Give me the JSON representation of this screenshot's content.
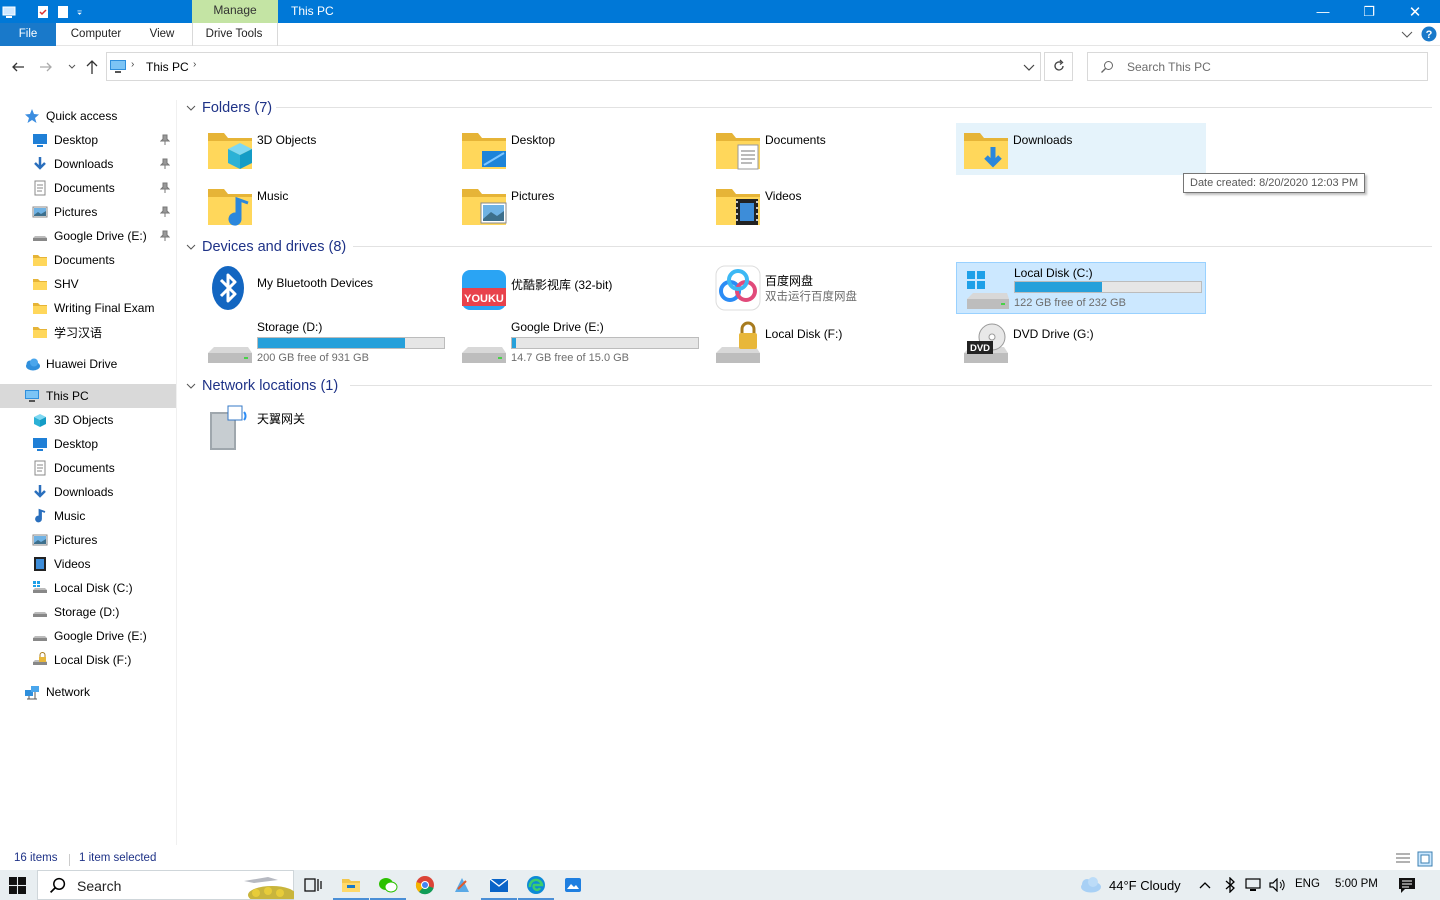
{
  "window": {
    "title": "This PC",
    "context_tab": "Manage",
    "controls": {
      "minimize": "—",
      "maximize": "❐",
      "close": "✕"
    }
  },
  "ribbon": {
    "tabs": [
      "File",
      "Computer",
      "View",
      "Drive Tools"
    ]
  },
  "address": {
    "path": [
      "This PC"
    ],
    "search_placeholder": "Search This PC"
  },
  "sidebar": {
    "quick_access": "Quick access",
    "quick_items": [
      {
        "label": "Desktop",
        "icon": "desktop-icon",
        "pinned": true
      },
      {
        "label": "Downloads",
        "icon": "downloads-icon",
        "pinned": true
      },
      {
        "label": "Documents",
        "icon": "documents-icon",
        "pinned": true
      },
      {
        "label": "Pictures",
        "icon": "pictures-icon",
        "pinned": true
      },
      {
        "label": "Google Drive (E:)",
        "icon": "drive-icon",
        "pinned": true
      },
      {
        "label": "Documents",
        "icon": "folder-icon",
        "pinned": false
      },
      {
        "label": "SHV",
        "icon": "folder-icon",
        "pinned": false
      },
      {
        "label": "Writing Final Exam",
        "icon": "folder-icon",
        "pinned": false
      },
      {
        "label": "学习汉语",
        "icon": "folder-icon",
        "pinned": false
      }
    ],
    "huawei": "Huawei Drive",
    "this_pc": "This PC",
    "pc_items": [
      {
        "label": "3D Objects",
        "icon": "3d-objects-icon"
      },
      {
        "label": "Desktop",
        "icon": "desktop-icon"
      },
      {
        "label": "Documents",
        "icon": "documents-icon"
      },
      {
        "label": "Downloads",
        "icon": "downloads-icon"
      },
      {
        "label": "Music",
        "icon": "music-icon"
      },
      {
        "label": "Pictures",
        "icon": "pictures-icon"
      },
      {
        "label": "Videos",
        "icon": "videos-icon"
      },
      {
        "label": "Local Disk (C:)",
        "icon": "windows-drive-icon"
      },
      {
        "label": "Storage (D:)",
        "icon": "drive-icon"
      },
      {
        "label": "Google Drive (E:)",
        "icon": "drive-icon"
      },
      {
        "label": "Local Disk (F:)",
        "icon": "locked-drive-icon"
      }
    ],
    "network": "Network"
  },
  "groups": {
    "folders": "Folders (7)",
    "drives": "Devices and drives (8)",
    "network": "Network locations (1)"
  },
  "folders": [
    {
      "name": "3D Objects",
      "icon": "3d-objects-folder-icon"
    },
    {
      "name": "Desktop",
      "icon": "desktop-folder-icon"
    },
    {
      "name": "Documents",
      "icon": "documents-folder-icon"
    },
    {
      "name": "Downloads",
      "icon": "downloads-folder-icon"
    },
    {
      "name": "Music",
      "icon": "music-folder-icon"
    },
    {
      "name": "Pictures",
      "icon": "pictures-folder-icon"
    },
    {
      "name": "Videos",
      "icon": "videos-folder-icon"
    }
  ],
  "tooltip": "Date created: 8/20/2020 12:03 PM",
  "devices": {
    "bluetooth": "My Bluetooth Devices",
    "youku": "优酷影视库 (32-bit)",
    "baidu": {
      "name": "百度网盘",
      "sub": "双击运行百度网盘"
    },
    "c": {
      "name": "Local Disk (C:)",
      "free": "122 GB free of 232 GB",
      "used_fraction": 0.47
    },
    "d": {
      "name": "Storage (D:)",
      "free": "200 GB free of 931 GB",
      "used_fraction": 0.79
    },
    "e": {
      "name": "Google Drive (E:)",
      "free": "14.7 GB free of 15.0 GB",
      "used_fraction": 0.02
    },
    "f": {
      "name": "Local Disk (F:)"
    },
    "g": {
      "name": "DVD Drive (G:)",
      "badge": "DVD"
    }
  },
  "network_locations": [
    {
      "name": "天翼网关"
    }
  ],
  "status": {
    "count": "16 items",
    "selection": "1 item selected"
  },
  "taskbar": {
    "search": "Search",
    "weather": "44°F  Cloudy",
    "lang": "ENG",
    "time": "5:00 PM"
  }
}
